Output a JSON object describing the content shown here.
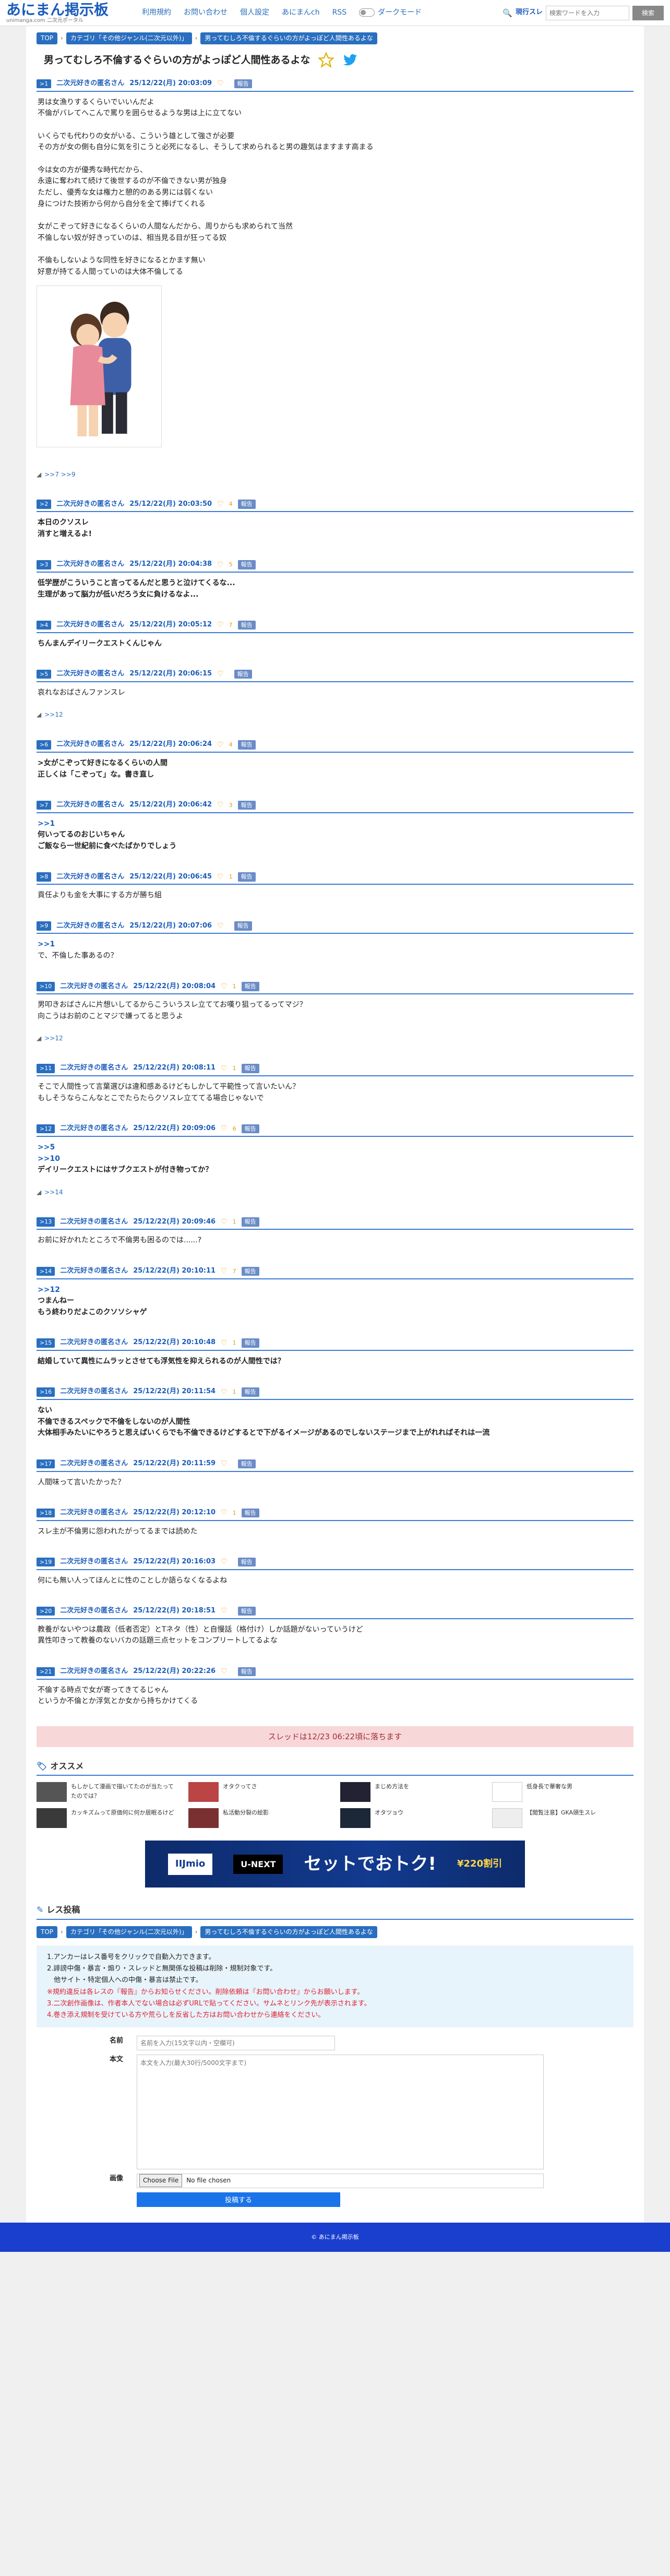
{
  "header": {
    "logo_main": "あにまん掲示板",
    "logo_sub": "unimanga.com 二次元ポータル",
    "nav": [
      "利用規約",
      "お問い合わせ",
      "個人設定",
      "あにまんch",
      "RSS"
    ],
    "dark_mode": "ダークモード",
    "search_label": "現行スレ",
    "search_placeholder": "検索ワードを入力",
    "search_button": "検索"
  },
  "breadcrumb": [
    "TOP",
    "カテゴリ「その他ジャンル(二次元以外)」",
    "男ってむしろ不倫するぐらいの方がよっぽど人間性あるよな"
  ],
  "thread_title": "男ってむしろ不倫するぐらいの方がよっぽど人間性あるよな",
  "posts": [
    {
      "no": ">1",
      "name": "二次元好きの匿名さん",
      "date": "25/12/22(月) 20:03:09",
      "likes": "",
      "report": "報告",
      "bold": false,
      "body": "男は女漁りするくらいでいいんだよ\n不倫がバレてへこんで罵りを囲らせるような男は上に立てない\n\nいくらでも代わりの女がいる、こういう雄として強さが必要\nその方が女の側も自分に気を引こうと必死になるし、そうして求められると男の趣気はますます高まる\n\n今は女の方が優秀な時代だから、\n永遠に奪われて続けて後世するのが不倫できない男が独身\nただし、優秀な女は権力と憩的のある男には弱くない\n身につけた技術から何から自分を全て捧げてくれる\n\n女がこぞって好きになるくらいの人間なんだから、周りからも求められて当然\n不倫しない奴が好きっていのは、相当見る目が狂ってる奴\n\n不倫もしないような同性を好きになるとかます無い\n好意が持てる人間っていのは大体不倫してる",
      "illust": true,
      "replies": ">>7 >>9"
    },
    {
      "no": ">2",
      "name": "二次元好きの匿名さん",
      "date": "25/12/22(月) 20:03:50",
      "likes": "4",
      "report": "報告",
      "bold": true,
      "body": "本日のクソスレ\n消すと増えるよ!",
      "illust": false,
      "replies": ""
    },
    {
      "no": ">3",
      "name": "二次元好きの匿名さん",
      "date": "25/12/22(月) 20:04:38",
      "likes": "5",
      "report": "報告",
      "bold": true,
      "body": "低学歴がこういうこと言ってるんだと思うと泣けてくるな...\n生理があって脳力が低いだろう女に負けるなよ...",
      "illust": false,
      "replies": ""
    },
    {
      "no": ">4",
      "name": "二次元好きの匿名さん",
      "date": "25/12/22(月) 20:05:12",
      "likes": "7",
      "report": "報告",
      "bold": true,
      "body": "ちんまんデイリークエストくんじゃん",
      "illust": false,
      "replies": ""
    },
    {
      "no": ">5",
      "name": "二次元好きの匿名さん",
      "date": "25/12/22(月) 20:06:15",
      "likes": "",
      "report": "報告",
      "bold": false,
      "body": "哀れなおばさんファンスレ",
      "illust": false,
      "replies": ">>12"
    },
    {
      "no": ">6",
      "name": "二次元好きの匿名さん",
      "date": "25/12/22(月) 20:06:24",
      "likes": "4",
      "report": "報告",
      "bold": true,
      "body": ">女がこぞって好きになるくらいの人間\n正しくは「こぞって」な。書き直し",
      "illust": false,
      "replies": ""
    },
    {
      "no": ">7",
      "name": "二次元好きの匿名さん",
      "date": "25/12/22(月) 20:06:42",
      "likes": "3",
      "report": "報告",
      "bold": true,
      "body": ">>1\n何いってるのおじいちゃん\nご飯なら一世紀前に食べたばかりでしょう",
      "illust": false,
      "replies": ""
    },
    {
      "no": ">8",
      "name": "二次元好きの匿名さん",
      "date": "25/12/22(月) 20:06:45",
      "likes": "1",
      "report": "報告",
      "bold": false,
      "body": "貢任よりも金を大事にする方が勝ち組",
      "illust": false,
      "replies": ""
    },
    {
      "no": ">9",
      "name": "二次元好きの匿名さん",
      "date": "25/12/22(月) 20:07:06",
      "likes": "",
      "report": "報告",
      "bold": false,
      "body": ">>1\nで、不倫した事あるの？",
      "illust": false,
      "replies": ""
    },
    {
      "no": ">10",
      "name": "二次元好きの匿名さん",
      "date": "25/12/22(月) 20:08:04",
      "likes": "1",
      "report": "報告",
      "bold": false,
      "body": "男叩きおばさんに片想いしてるからこういうスレ立ててお嘆り狙ってるってマジ？\n向こうはお前のことマジで嫌ってると思うよ",
      "illust": false,
      "replies": ">>12"
    },
    {
      "no": ">11",
      "name": "二次元好きの匿名さん",
      "date": "25/12/22(月) 20:08:11",
      "likes": "1",
      "report": "報告",
      "bold": false,
      "body": "そこで人間性って言葉選びは違和感あるけどもしかして平範性って言いたいん？\nもしそうならこんなとこでたらたらクソスレ立ててる場合じゃないで",
      "illust": false,
      "replies": ""
    },
    {
      "no": ">12",
      "name": "二次元好きの匿名さん",
      "date": "25/12/22(月) 20:09:06",
      "likes": "6",
      "report": "報告",
      "bold": true,
      "body": ">>5\n>>10\nデイリークエストにはサブクエストが付き物ってか？",
      "illust": false,
      "replies": ">>14"
    },
    {
      "no": ">13",
      "name": "二次元好きの匿名さん",
      "date": "25/12/22(月) 20:09:46",
      "likes": "1",
      "report": "報告",
      "bold": false,
      "body": "お前に好かれたところで不倫男も困るのでは......?",
      "illust": false,
      "replies": ""
    },
    {
      "no": ">14",
      "name": "二次元好きの匿名さん",
      "date": "25/12/22(月) 20:10:11",
      "likes": "7",
      "report": "報告",
      "bold": true,
      "body": ">>12\nつまんねー\nもう終わりだよこのクソソシャゲ",
      "illust": false,
      "replies": ""
    },
    {
      "no": ">15",
      "name": "二次元好きの匿名さん",
      "date": "25/12/22(月) 20:10:48",
      "likes": "1",
      "report": "報告",
      "bold": true,
      "body": "結婚していて異性にムラッとさせても浮気性を抑えられるのが人間性では？",
      "illust": false,
      "replies": ""
    },
    {
      "no": ">16",
      "name": "二次元好きの匿名さん",
      "date": "25/12/22(月) 20:11:54",
      "likes": "1",
      "report": "報告",
      "bold": true,
      "body": "ない\n不倫できるスペックで不倫をしないのが人間性\n大体相手みたいにやろうと思えばいくらでも不倫できるけどするとで下がるイメージがあるのでしないステージまで上がれればそれは一流",
      "illust": false,
      "replies": ""
    },
    {
      "no": ">17",
      "name": "二次元好きの匿名さん",
      "date": "25/12/22(月) 20:11:59",
      "likes": "",
      "report": "報告",
      "bold": false,
      "body": "人間味って言いたかった？",
      "illust": false,
      "replies": ""
    },
    {
      "no": ">18",
      "name": "二次元好きの匿名さん",
      "date": "25/12/22(月) 20:12:10",
      "likes": "1",
      "report": "報告",
      "bold": false,
      "body": "スレ主が不倫男に怨われたがってるまでは読めた",
      "illust": false,
      "replies": ""
    },
    {
      "no": ">19",
      "name": "二次元好きの匿名さん",
      "date": "25/12/22(月) 20:16:03",
      "likes": "",
      "report": "報告",
      "bold": false,
      "body": "何にも無い人ってほんとに性のことしか語らなくなるよね",
      "illust": false,
      "replies": ""
    },
    {
      "no": ">20",
      "name": "二次元好きの匿名さん",
      "date": "25/12/22(月) 20:18:51",
      "likes": "",
      "report": "報告",
      "bold": false,
      "body": "教養がないやつは農政（低者否定）とTネタ（性）と自慢話（格付け）しか話題がないっていうけど\n異性叩きって教養のないバカの話題三点セットをコンプリートしてるよな",
      "illust": false,
      "replies": ""
    },
    {
      "no": ">21",
      "name": "二次元好きの匿名さん",
      "date": "25/12/22(月) 20:22:26",
      "likes": "",
      "report": "報告",
      "bold": false,
      "body": "不倫する時点で女が寄ってきてるじゃん\nというか不倫とか浮気とか女から持ちかけてくる",
      "illust": false,
      "replies": ""
    }
  ],
  "notice": "スレッドは12/23 06:22頃に落ちます",
  "recommend_title": "オススメ",
  "recommend": [
    "もしかして漫画で描いてたのが当たってたのでは？",
    "オタクってさ",
    "まじめ方法を",
    "低身長で華奢な男",
    "カッキズムって原価何に何か居眠るけど",
    "私活動分裂の絵影",
    "オタツョウ",
    "【閲覧注意】GKA頭生スレ"
  ],
  "ad": {
    "brand1": "IIJmio",
    "brand2": "U-NEXT",
    "main": "セットでおトク!",
    "price": "¥220割引"
  },
  "form": {
    "title": "レス投稿",
    "breadcrumb": [
      "TOP",
      "カテゴリ「その他ジャンル(二次元以外)」",
      "男ってむしろ不倫するぐらいの方がよっぽど人間性あるよな"
    ],
    "rules": [
      "1.アンカーはレス番号をクリックで自動入力できます。",
      "2.誹謗中傷・暴言・煽り・スレッドと無関係な投稿は削除・規制対象です。",
      "　他サイト・特定個人への中傷・暴言は禁止です。",
      "※規約違反は各レスの『報告』からお知らせください。削除依頼は『お問い合わせ』からお願いします。",
      "3.二次創作画像は、作者本人でない場合は必ずURLで貼ってください。サムネとリンク先が表示されます。",
      "4.巻き添え規制を受けている方や荒らしを反省した方はお問い合わせから連絡をください。"
    ],
    "name_label": "名前",
    "name_placeholder": "名前を入力(15文字以内・空欄可)",
    "body_label": "本文",
    "body_placeholder": "本文を入力(最大30行/5000文字まで)",
    "image_label": "画像",
    "file_button": "Choose File",
    "file_status": "No file chosen",
    "submit": "投稿する"
  },
  "footer": "© あにまん掲示板"
}
